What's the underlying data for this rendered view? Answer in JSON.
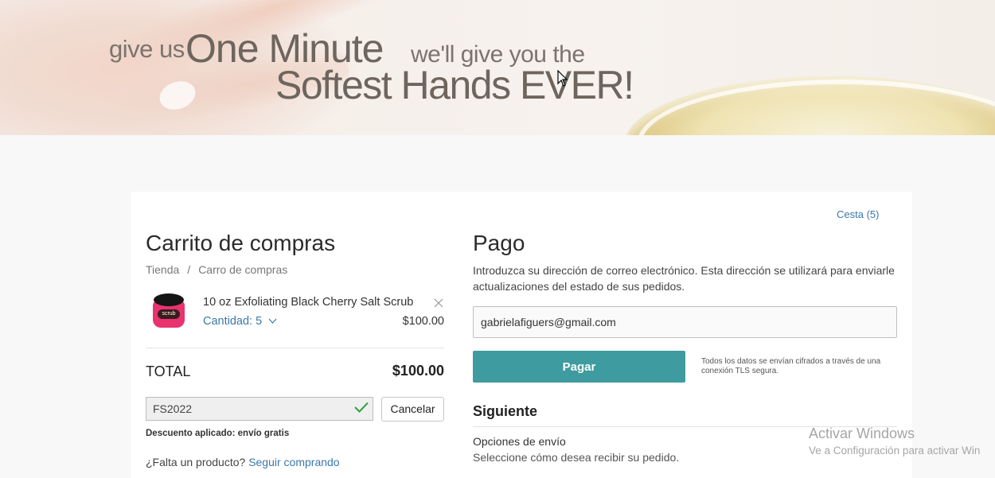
{
  "banner": {
    "line1_small": "give us",
    "line1_large": "One Minute",
    "line1_tail": "we'll give you the",
    "line2": "Softest Hands EVER!"
  },
  "header": {
    "basket_link": "Cesta (5)"
  },
  "cart": {
    "title": "Carrito de compras",
    "breadcrumb": [
      "Tienda",
      "/",
      "Carro de compras"
    ],
    "item": {
      "name": "10 oz Exfoliating Black Cherry Salt Scrub",
      "image_label": "scrub",
      "quantity": "Cantidad: 5",
      "price": "$100.00",
      "remove_icon": "close-icon"
    },
    "total_label": "TOTAL",
    "total_value": "$100.00",
    "coupon_code": "FS2022",
    "cancel_label": "Cancelar",
    "discount_note": "Descuento aplicado: envío gratis",
    "missing_text": "¿Falta un producto?",
    "continue_link": "Seguir comprando"
  },
  "payment": {
    "title": "Pago",
    "description": "Introduzca su dirección de correo electrónico. Esta dirección se utilizará para enviarle actualizaciones del estado de sus pedidos.",
    "email_value": "gabrielafiguers@gmail.com",
    "pay_label": "Pagar",
    "secure_note": "Todos los datos se envían cifrados a través de una conexión TLS segura.",
    "next_title": "Siguiente",
    "shipping_title": "Opciones de envío",
    "shipping_desc": "Seleccione cómo desea recibir su pedido."
  },
  "watermark": {
    "title": "Activar Windows",
    "subtitle": "Ve a Configuración para activar Win"
  },
  "colors": {
    "accent_link": "#3b78a8",
    "pay_button": "#3e9ba0",
    "check": "#2ea043"
  }
}
